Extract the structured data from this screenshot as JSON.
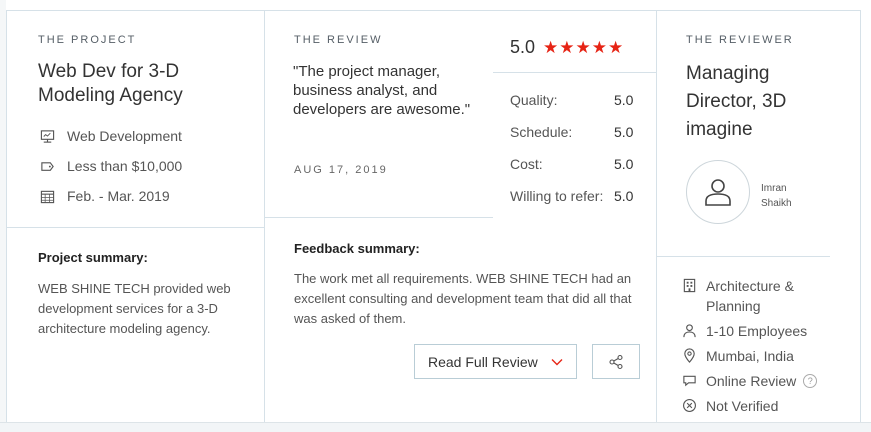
{
  "project": {
    "eyebrow": "THE PROJECT",
    "title_line1": "Web Dev for 3-D",
    "title_line2": "Modeling Agency",
    "service": "Web Development",
    "budget": "Less than $10,000",
    "dates": "Feb. - Mar. 2019",
    "summary_heading": "Project summary:",
    "summary_text": "WEB SHINE TECH provided web development services for a 3-D architecture modeling agency."
  },
  "review": {
    "eyebrow": "THE REVIEW",
    "quote": "\"The project manager, business analyst, and developers are awesome.\"",
    "date": "AUG 17, 2019",
    "overall": "5.0",
    "stars": "★★★★★",
    "star_count": 5,
    "ratings": [
      {
        "label": "Quality:",
        "value": "5.0"
      },
      {
        "label": "Schedule:",
        "value": "5.0"
      },
      {
        "label": "Cost:",
        "value": "5.0"
      },
      {
        "label": "Willing to refer:",
        "value": "5.0"
      }
    ],
    "feedback_heading": "Feedback summary:",
    "feedback_text": "The work met all requirements. WEB SHINE TECH had an excellent consulting and development team that did all that was asked of them.",
    "read_full_label": "Read Full Review"
  },
  "reviewer": {
    "eyebrow": "THE REVIEWER",
    "title_line1": "Managing",
    "title_line2": "Director, 3D",
    "title_line3": "imagine",
    "name_line1": "Imran",
    "name_line2": "Shaikh",
    "industry_line1": "Architecture &",
    "industry_line2": "Planning",
    "employees": "1-10 Employees",
    "location": "Mumbai, India",
    "review_type": "Online Review",
    "help_mark": "?",
    "verification": "Not Verified"
  },
  "colors": {
    "star": "#e62415",
    "border": "#d6e1e8",
    "button_border": "#b9cdd6"
  }
}
